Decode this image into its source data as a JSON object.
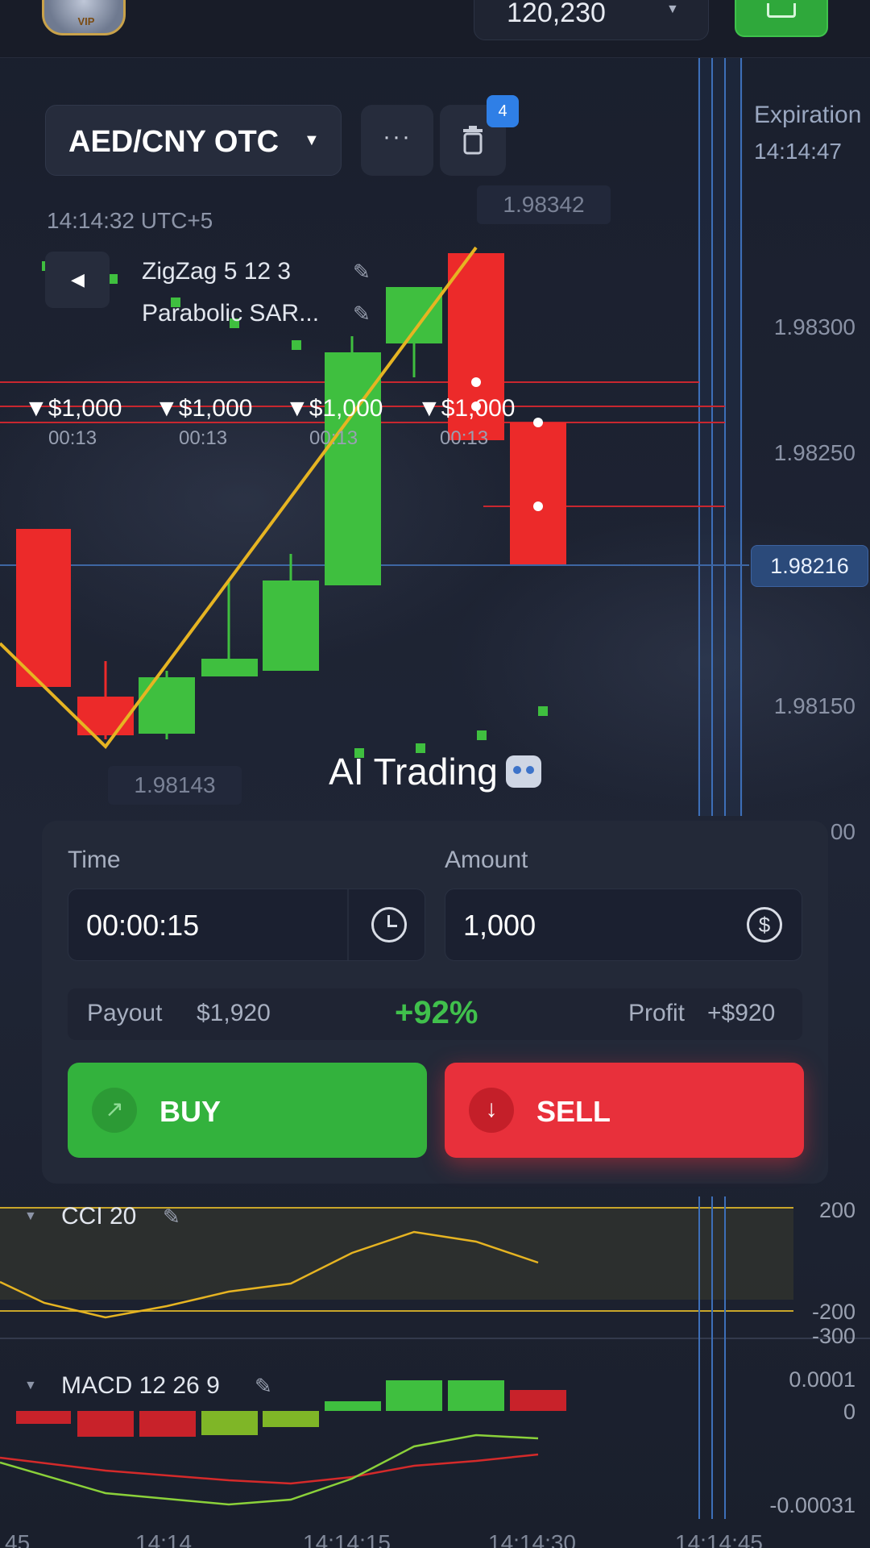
{
  "topbar": {
    "balance": "120,230",
    "vip": "VIP"
  },
  "chart": {
    "pair": "AED/CNY OTC",
    "more_label": "···",
    "trash_badge": "4",
    "server_time": "14:14:32 UTC+5",
    "indicators": [
      "ZigZag 5 12 3",
      "Parabolic SAR..."
    ],
    "price_label_top": "1.98342",
    "price_label_low": "1.98143",
    "current_price": "1.98216",
    "price_ticks": [
      "1.98300",
      "1.98250",
      "1.98150",
      "00"
    ],
    "expiration_label": "Expiration",
    "expiration_time": "14:14:47",
    "trades": [
      {
        "amount": "▼$1,000",
        "time": "00:13"
      },
      {
        "amount": "▼$1,000",
        "time": "00:13"
      },
      {
        "amount": "▼$1,000",
        "time": "00:13"
      },
      {
        "amount": "▼$1,000",
        "time": "00:13"
      }
    ],
    "caption": "AI Trading"
  },
  "trade_panel": {
    "time_label": "Time",
    "time_value": "00:00:15",
    "amount_label": "Amount",
    "amount_value": "1,000",
    "payout_label": "Payout",
    "payout_value": "$1,920",
    "payout_percent": "+92%",
    "profit_label": "Profit",
    "profit_value": "+$920",
    "buy_label": "BUY",
    "sell_label": "SELL"
  },
  "cci": {
    "title": "CCI 20",
    "ticks": [
      "200",
      "-200",
      "-300"
    ]
  },
  "macd": {
    "title": "MACD  12 26 9",
    "ticks": [
      "0.0001",
      "0",
      "-0.00031"
    ]
  },
  "time_axis": [
    "45",
    "14:14",
    "14:14:15",
    "14:14:30",
    "14:14:45"
  ],
  "colors": {
    "up": "#3fbf3f",
    "down": "#ec2a2a",
    "zigzag": "#e6b422",
    "buy": "#33b23d",
    "sell": "#e8303b",
    "accent": "#2f7fe6"
  },
  "icons": [
    "vip-badge-icon",
    "chevron-down-icon",
    "more-dots-icon",
    "trash-icon",
    "chevron-left-icon",
    "pencil-icon",
    "clock-icon",
    "dollar-icon",
    "arrow-up-right-icon",
    "arrow-down-icon",
    "robot-icon"
  ]
}
